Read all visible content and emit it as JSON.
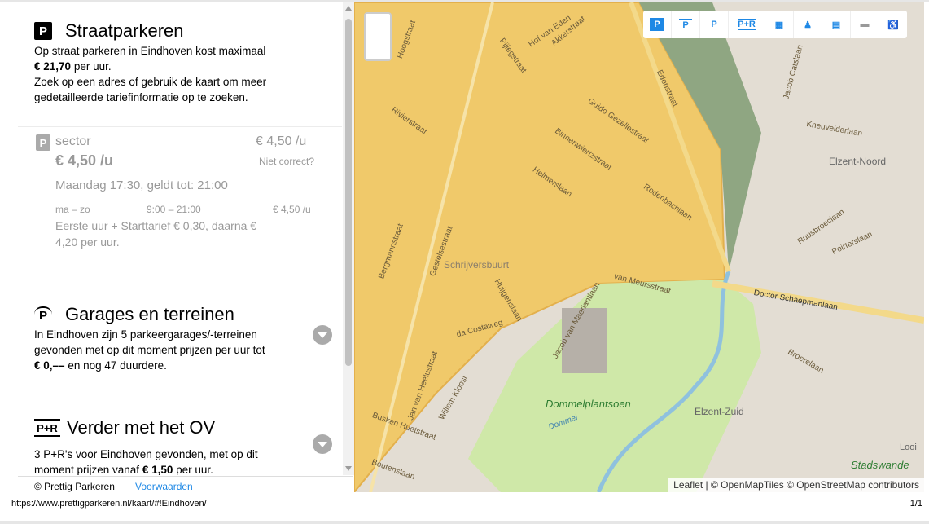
{
  "street": {
    "title": "Straatparkeren",
    "line1": "Op straat parkeren in Eindhoven kost maximaal",
    "price_max": "€ 21,70",
    "per_hour": "per uur.",
    "line3": "Zoek op een adres of gebruik de kaart om meer",
    "line4": "gedetailleerde tariefinformatie op te zoeken."
  },
  "sector": {
    "label": "sector",
    "rate_right": "€ 4,50 /u",
    "rate_big": "€ 4,50 /u",
    "not_correct": "Niet correct?",
    "day_valid": "Maandag 17:30, geldt tot: 21:00",
    "days": "ma – zo",
    "hours": "9:00 – 21:00",
    "hour_rate": "€ 4,50 /u",
    "note1": "Eerste uur + Starttarief € 0,30, daarna €",
    "note2": "4,20 per uur."
  },
  "garages": {
    "title": "Garages en terreinen",
    "line1": "In Eindhoven zijn 5 parkeergarages/-terreinen",
    "line2": "gevonden met op dit moment prijzen per uur tot",
    "price": "€ 0,––",
    "rest": "en nog 47 duurdere."
  },
  "ov": {
    "icon": "P+R",
    "title": "Verder met het OV",
    "line1": "3 P+R's voor Eindhoven gevonden, met op dit",
    "line2_prefix": "moment prijzen vanaf",
    "price": "€ 1,50",
    "suffix": "per uur."
  },
  "footer": {
    "copyright": "© Prettig Parkeren",
    "terms": "Voorwaarden"
  },
  "status": {
    "url": "https://www.prettigparkeren.nl/kaart/#!Eindhoven/",
    "page": "1/1"
  },
  "map": {
    "attribution": "Leaflet | © OpenMapTiles © OpenStreetMap contributors",
    "toolbar": [
      "P",
      "P",
      "P",
      "P+R",
      "",
      "",
      "",
      "",
      ""
    ],
    "labels": {
      "hoogstraat": "Hoogstraat",
      "rivierstraat": "Rivierstraat",
      "piusstraat": "Pijlegstraat",
      "akkerstraat": "Akkerstraat",
      "hofvaneden": "Hof van Eden",
      "guido": "Guido Gezellestraat",
      "binnenwiertz": "Binnenwiertzstraat",
      "helmerslaan": "Helmerslaan",
      "schrijversbuurt": "Schrijversbuurt",
      "gestelsestraat": "Gestelsestraat",
      "huijgenslaan": "Huijgenslaan",
      "vanmeurs": "van Meursstraat",
      "rodenbach": "Rodenbachlaan",
      "jacobvanm": "Jacob van Maerlantlaan",
      "dacostaweg": "da Costaweg",
      "edenstraat": "Edenstraat",
      "dommelplantsoen": "Dommelplantsoen",
      "dommel": "Dommel",
      "elzentnoord": "Elzent-Noord",
      "elzentzuid": "Elzent-Zuid",
      "doctorschaep": "Doctor Schaepmanlaan",
      "ruusbroec": "Ruusbroeclaan",
      "poirters": "Poirterslaan",
      "broerelaan": "Broerelaan",
      "jancats": "Jacob Catslaan",
      "stadswande": "Stadswande",
      "boutenslaan": "Boutenslaan",
      "bergmann": "Bergmannstraat",
      "willemkloos": "Willem Kloosl",
      "janvanheel": "Jan van Heelustraat",
      "busken": "Busken Huetstraat",
      "kneu": "Kneuvelderlaan",
      "looi": "Looi"
    }
  },
  "colors": {
    "map_zone": "#f0c96a",
    "map_green": "#cfe8a8",
    "map_gray": "#ded8ce",
    "link": "#1e88e5"
  }
}
